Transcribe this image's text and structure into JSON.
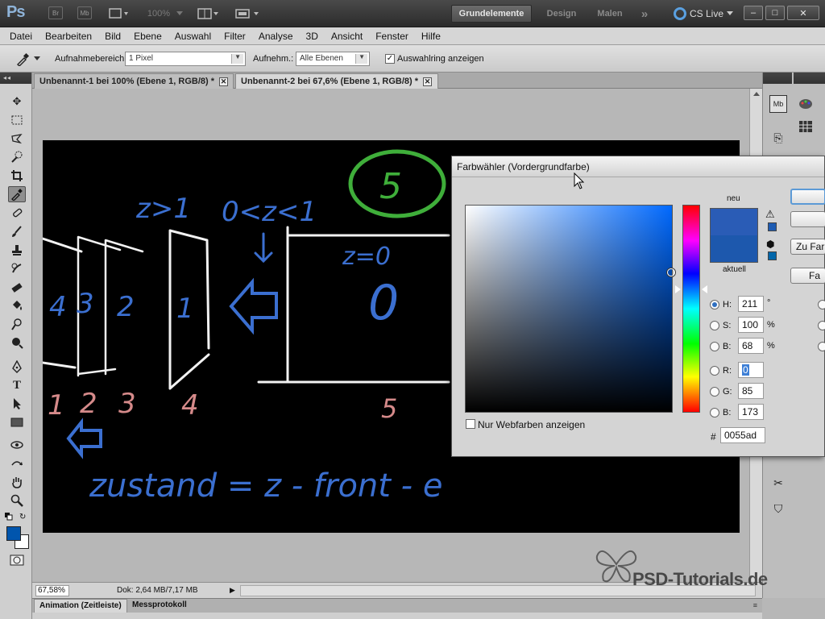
{
  "app": {
    "logo": "Ps",
    "toolbar_icons": [
      "Br",
      "Mb"
    ],
    "zoom_display": "100%",
    "workspaces": [
      "Grundelemente",
      "Design",
      "Malen"
    ],
    "more_workspaces": "»",
    "cs_live": "CS Live",
    "window_buttons": [
      "–",
      "□",
      "✕"
    ]
  },
  "menu": [
    "Datei",
    "Bearbeiten",
    "Bild",
    "Ebene",
    "Auswahl",
    "Filter",
    "Analyse",
    "3D",
    "Ansicht",
    "Fenster",
    "Hilfe"
  ],
  "options": {
    "sample_size_label": "Aufnahmebereich:",
    "sample_size_value": "1 Pixel",
    "sample_label": "Aufnehm.:",
    "sample_value": "Alle Ebenen",
    "show_ring_label": "Auswahlring anzeigen",
    "show_ring_checked": true
  },
  "tabs": [
    {
      "label": "Unbenannt-1 bei 100% (Ebene 1, RGB/8) *",
      "active": false
    },
    {
      "label": "Unbenannt-2 bei 67,6% (Ebene 1, RGB/8) *",
      "active": true
    }
  ],
  "canvas_sketch": {
    "equations": [
      "z>1",
      "0<z<1",
      "z=0",
      "zustand = z - front - e"
    ],
    "circled_number": "5",
    "layer_numbers": [
      "4",
      "3",
      "2",
      "1"
    ],
    "big_zero": "0",
    "bottom_numbers": [
      "1",
      "2",
      "3",
      "4",
      "5"
    ],
    "colors": {
      "blue": "#3b6fd0",
      "green": "#3fae3a",
      "pink": "#d58a8a",
      "white": "#f2f2f2"
    }
  },
  "color_picker": {
    "title": "Farbwähler (Vordergrundfarbe)",
    "new_label": "neu",
    "current_label": "aktuell",
    "hsb": [
      {
        "label": "H:",
        "value": "211",
        "unit": "°",
        "selected": true
      },
      {
        "label": "S:",
        "value": "100",
        "unit": "%",
        "selected": false
      },
      {
        "label": "B:",
        "value": "68",
        "unit": "%",
        "selected": false
      }
    ],
    "rgb": [
      {
        "label": "R:",
        "value": "0"
      },
      {
        "label": "G:",
        "value": "85"
      },
      {
        "label": "B:",
        "value": "173"
      }
    ],
    "hex_label": "#",
    "hex_value": "0055ad",
    "web_colors_label": "Nur Webfarben anzeigen",
    "buttons": [
      "Zu Far",
      "Fa"
    ],
    "new_color": "#2a5cb6",
    "current_color": "#1d58ad"
  },
  "tools": {
    "foreground_color": "#0055ad",
    "background_color": "#ffffff"
  },
  "status": {
    "zoom": "67,58%",
    "doc_info": "Dok: 2,64 MB/7,17 MB"
  },
  "bottom_tabs": [
    "Animation (Zeitleiste)",
    "Messprotokoll"
  ],
  "watermark": "PSD-Tutorials.de"
}
